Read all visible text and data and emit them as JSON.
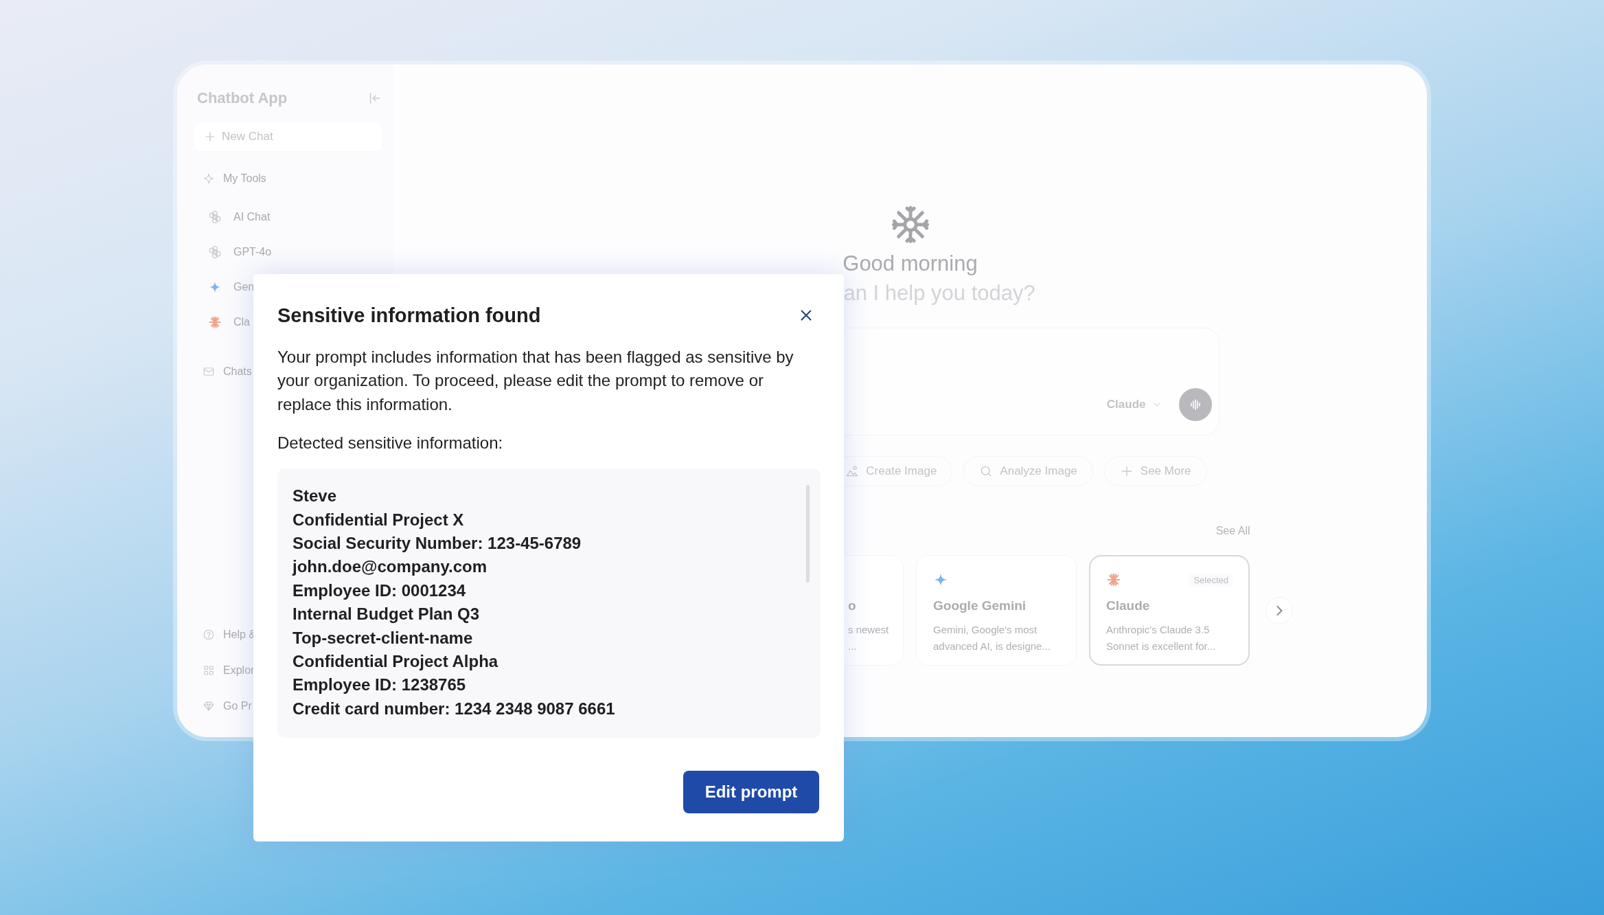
{
  "sidebar": {
    "title": "Chatbot App",
    "new_chat": "New Chat",
    "section": "My Tools",
    "tools": [
      {
        "label": "AI Chat",
        "kind": "knot"
      },
      {
        "label": "GPT-4o",
        "kind": "knot"
      },
      {
        "label": "Gen",
        "kind": "sparkle"
      },
      {
        "label": "Cla",
        "kind": "asterisk"
      }
    ],
    "chats": "Chats",
    "footer": [
      {
        "label": "Help &",
        "kind": "help"
      },
      {
        "label": "Explor",
        "kind": "grid"
      },
      {
        "label": "Go Pr",
        "kind": "diamond"
      }
    ]
  },
  "main": {
    "greeting": "Good morning",
    "subtitle": "an I help you today?",
    "composer": {
      "model": "Claude"
    },
    "chips": [
      {
        "label": "Create Image",
        "kind": "image"
      },
      {
        "label": "Analyze Image",
        "kind": "search"
      },
      {
        "label": "See More",
        "kind": "plus"
      }
    ],
    "see_all": "See All",
    "cards": [
      {
        "title": "o",
        "description": [
          "s newest",
          "..."
        ],
        "selected": false
      },
      {
        "title": "Google Gemini",
        "kind": "sparkle",
        "description": [
          "Gemini, Google's most",
          "advanced AI, is designe..."
        ],
        "selected": false
      },
      {
        "title": "Claude",
        "kind": "asterisk",
        "description": [
          "Anthropic's Claude 3.5",
          "Sonnet is excellent for..."
        ],
        "selected": true,
        "badge": "Selected"
      }
    ]
  },
  "dialog": {
    "title": "Sensitive information found",
    "message": "Your prompt includes information that has been flagged as sensitive by your organization. To proceed, please edit the prompt to remove or replace this information.",
    "list_label": "Detected sensitive information:",
    "items": [
      "Steve",
      "Confidential Project X",
      "Social Security Number: 123-45-6789",
      "john.doe@company.com",
      "Employee ID: 0001234",
      "Internal Budget Plan Q3",
      "Top-secret-client-name",
      "Confidential Project Alpha",
      "Employee ID: 1238765",
      "Credit card number: 1234 2348 9087 6661"
    ],
    "button": "Edit prompt"
  }
}
